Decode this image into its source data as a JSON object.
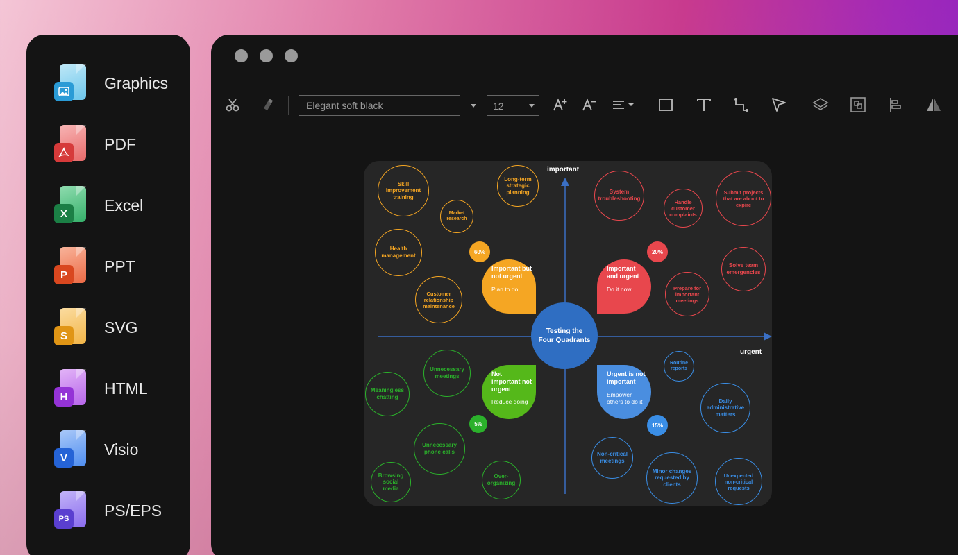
{
  "sidebar": {
    "items": [
      {
        "label": "Graphics",
        "icon": "image-file-icon",
        "badge": "",
        "color": "#4fb7e8"
      },
      {
        "label": "PDF",
        "icon": "pdf-file-icon",
        "badge": "",
        "color": "#e34b4b"
      },
      {
        "label": "Excel",
        "icon": "excel-file-icon",
        "badge": "X",
        "color": "#1f9d55"
      },
      {
        "label": "PPT",
        "icon": "ppt-file-icon",
        "badge": "P",
        "color": "#e8542e"
      },
      {
        "label": "SVG",
        "icon": "svg-file-icon",
        "badge": "S",
        "color": "#f0a524"
      },
      {
        "label": "HTML",
        "icon": "html-file-icon",
        "badge": "H",
        "color": "#a245e0"
      },
      {
        "label": "Visio",
        "icon": "visio-file-icon",
        "badge": "V",
        "color": "#2f74e6"
      },
      {
        "label": "PS/EPS",
        "icon": "ps-file-icon",
        "badge": "PS",
        "color": "#6a4fe0"
      }
    ]
  },
  "toolbar": {
    "font_name": "Elegant soft black",
    "font_size": "12"
  },
  "diagram": {
    "axis_y_label": "important",
    "axis_x_label": "urgent",
    "center_line1": "Testing the",
    "center_line2": "Four Quadrants",
    "quadrants": {
      "top_left": {
        "title": "Important but not urgent",
        "sub": "Plan to do",
        "pct": "60%",
        "color": "#f5a623"
      },
      "top_right": {
        "title": "Important and urgent",
        "sub": "Do it now",
        "pct": "20%",
        "color": "#e8474d"
      },
      "bottom_left": {
        "title": "Not important not urgent",
        "sub": "Reduce doing",
        "pct": "5%",
        "color": "#2bb12b"
      },
      "bottom_right": {
        "title": "Urgent is not important",
        "sub": "Empower others to do it",
        "pct": "15%",
        "color": "#3a8ee6"
      }
    },
    "bubbles": {
      "orange": [
        "Skill improvement training",
        "Long-term strategic planning",
        "Market research",
        "Health management",
        "Customer relationship maintenance"
      ],
      "red": [
        "System troubleshooting",
        "Handle customer complaints",
        "Submit projects that are about to expire",
        "Solve team emergencies",
        "Prepare for important meetings"
      ],
      "green": [
        "Unnecessary meetings",
        "Meaningless chatting",
        "Unnecessary phone calls",
        "Browsing social media",
        "Over-organizing"
      ],
      "blue": [
        "Routine reports",
        "Daily administrative matters",
        "Non-critical meetings",
        "Minor changes requested by clients",
        "Unexpected non-critical requests"
      ]
    }
  }
}
